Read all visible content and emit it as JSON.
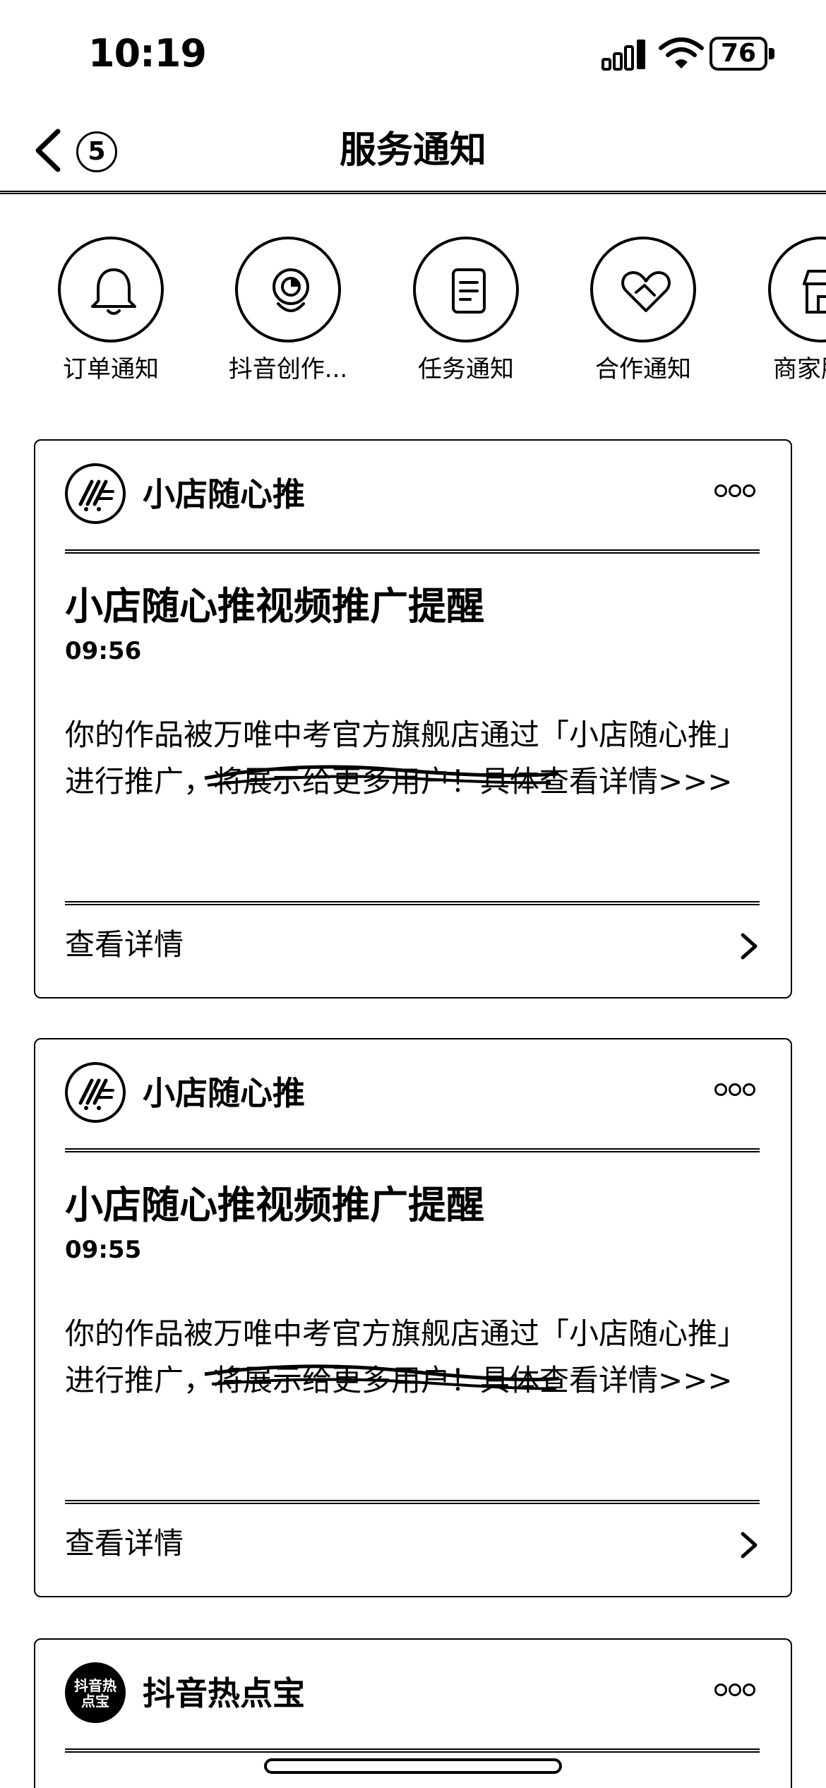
{
  "status_bar": {
    "time": "10:19",
    "battery": "76"
  },
  "nav": {
    "title": "服务通知",
    "unread_count": "5"
  },
  "categories": [
    {
      "label": "订单通知",
      "icon": "bell-icon"
    },
    {
      "label": "抖音创作...",
      "icon": "creator-icon"
    },
    {
      "label": "任务通知",
      "icon": "task-doc-icon"
    },
    {
      "label": "合作通知",
      "icon": "cooperation-heart-icon"
    },
    {
      "label": "商家服务",
      "icon": "shop-icon"
    }
  ],
  "notifications": [
    {
      "sender": "小店随心推",
      "title": "小店随心推视频推广提醒",
      "time": "09:56",
      "body": "你的作品被万唯中考官方旗舰店通过「小店随心推」进行推广，将展示给更多用户！具体查看详情>>>",
      "link": "查看详情"
    },
    {
      "sender": "小店随心推",
      "title": "小店随心推视频推广提醒",
      "time": "09:55",
      "body": "你的作品被万唯中考官方旗舰店通过「小店随心推」进行推广，将展示给更多用户！具体查看详情>>>",
      "link": "查看详情"
    },
    {
      "sender": "抖音热点宝",
      "avatar_text": "抖音热点宝"
    }
  ]
}
